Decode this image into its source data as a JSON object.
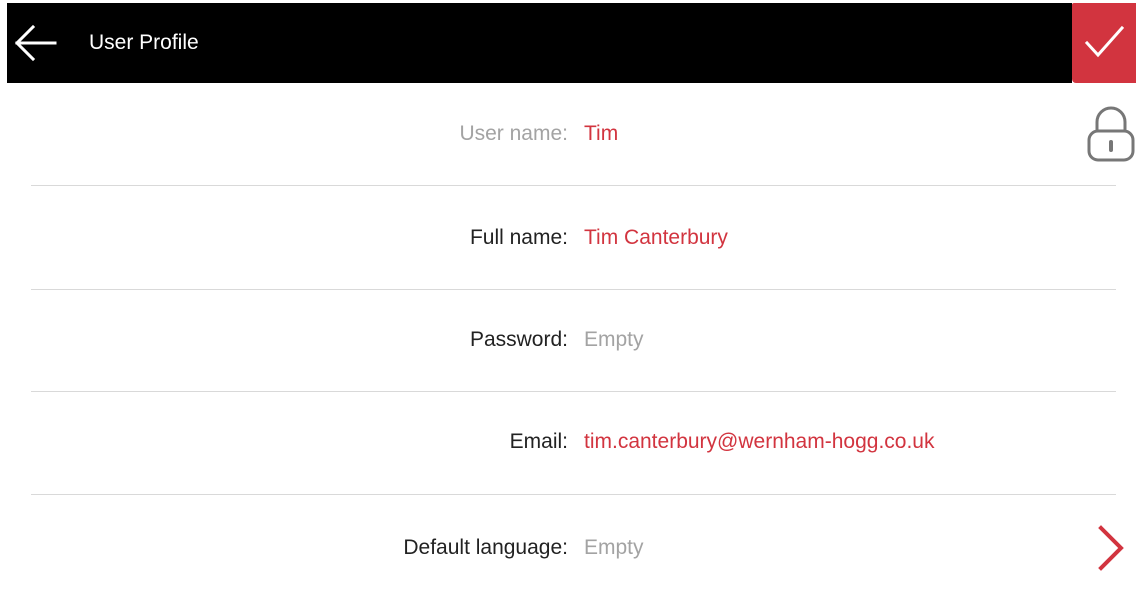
{
  "header": {
    "title": "User Profile",
    "accent_color": "#d2343f",
    "bar_color": "#000000",
    "back_icon": "arrow-left-icon",
    "confirm_icon": "checkmark-icon"
  },
  "fields": [
    {
      "label": "User name:",
      "value": "Tim",
      "locked": true,
      "value_state": "filled"
    },
    {
      "label": "Full name:",
      "value": "Tim Canterbury",
      "value_state": "filled"
    },
    {
      "label": "Password:",
      "value": "Empty",
      "value_state": "empty"
    },
    {
      "label": "Email:",
      "value": "tim.canterbury@wernham-hogg.co.uk",
      "value_state": "filled"
    },
    {
      "label": "Default language:",
      "value": "Empty",
      "value_state": "empty",
      "has_chevron": true
    }
  ],
  "icons": {
    "lock": "lock-icon",
    "chevron": "chevron-right-icon"
  }
}
